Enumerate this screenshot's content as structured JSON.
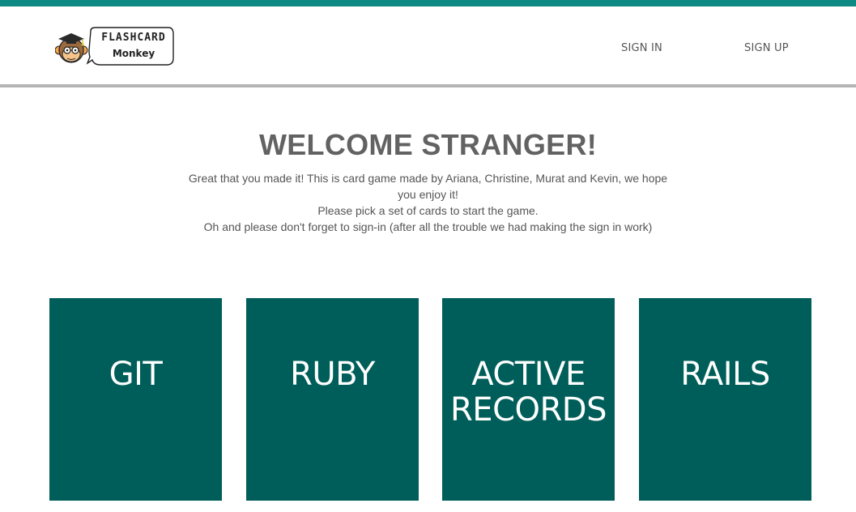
{
  "header": {
    "logo": {
      "text_top": "FLASHCARD",
      "text_bottom": "Monkey",
      "icon": "monkey-mascot-icon"
    },
    "nav": {
      "sign_in": "SIGN IN",
      "sign_up": "SIGN UP"
    }
  },
  "welcome": {
    "title": "WELCOME STRANGER!",
    "lines": [
      "Great that you made it! This is card game made by Ariana, Christine, Murat and Kevin, we hope you enjoy it!",
      "Please pick a set of cards to start the game.",
      "Oh and please don't forget to sign-in (after all the trouble we had making the sign in work)"
    ]
  },
  "cards": [
    {
      "label": "GIT"
    },
    {
      "label": "RUBY"
    },
    {
      "label": "ACTIVE RECORDS"
    },
    {
      "label": "RAILS"
    }
  ],
  "colors": {
    "accent_strip": "#0e8a84",
    "card_background": "#005e5a",
    "title_text": "#626262",
    "body_text": "#555555"
  }
}
